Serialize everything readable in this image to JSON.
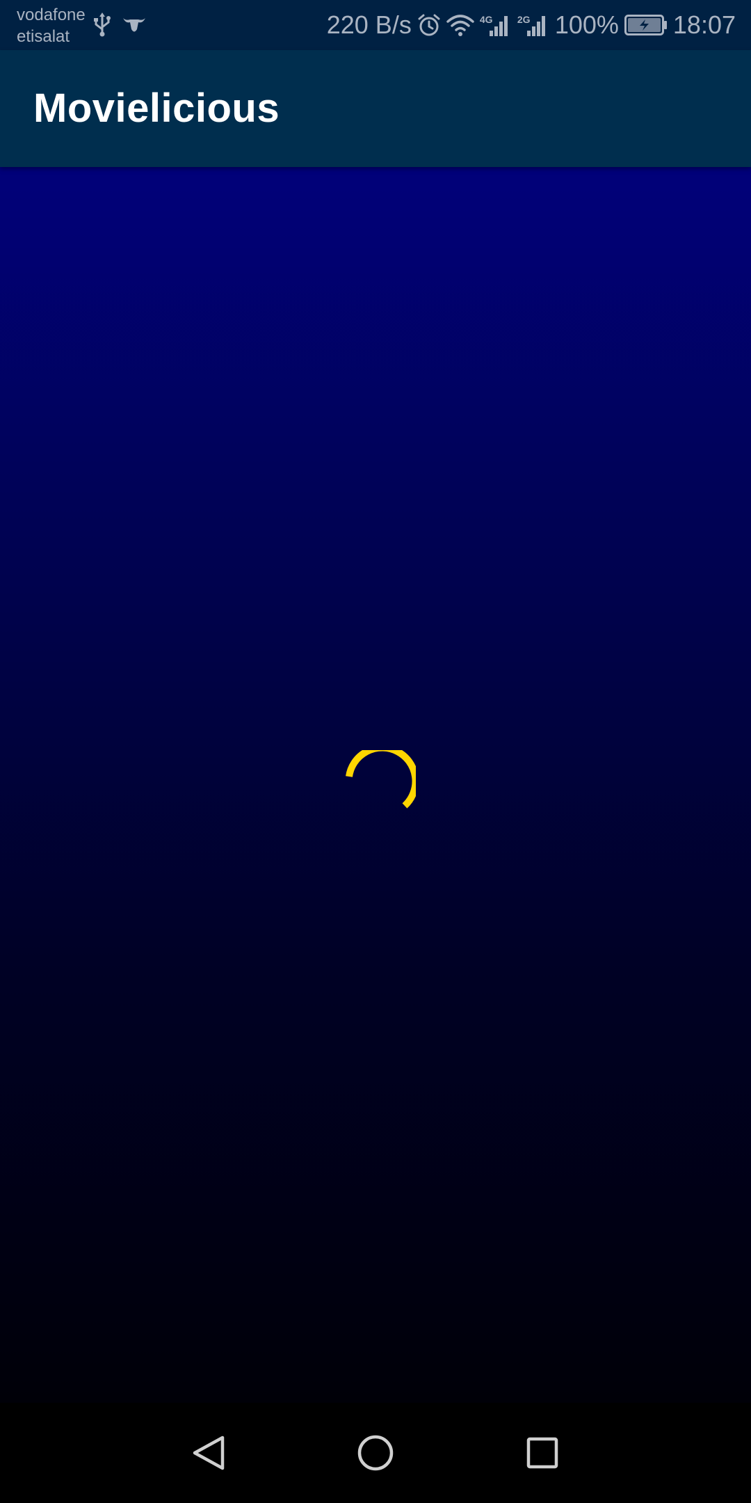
{
  "status_bar": {
    "carrier_1": "vodafone",
    "carrier_2": "etisalat",
    "network_speed": "220 B/s",
    "signal_1_type": "4G",
    "signal_2_type": "2G",
    "battery_percent": "100%",
    "time": "18:07",
    "icons": [
      "usb-icon",
      "bull-icon",
      "alarm-icon",
      "wifi-icon",
      "signal-icon",
      "signal-icon",
      "battery-charging-icon"
    ]
  },
  "app_bar": {
    "title": "Movielicious"
  },
  "content": {
    "state": "loading",
    "spinner_color": "#FFD600"
  },
  "nav_bar": {
    "buttons": [
      "back-icon",
      "home-icon",
      "recent-apps-icon"
    ]
  }
}
